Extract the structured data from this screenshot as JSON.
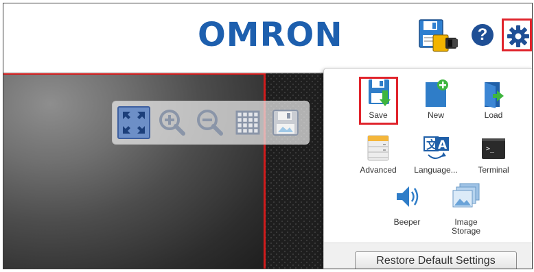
{
  "header": {
    "brand": "OMRON",
    "brand_color": "#1d5fae",
    "icons": [
      "save-to-camera-icon",
      "help-icon",
      "gear-icon"
    ],
    "help_glyph": "?"
  },
  "viewer_toolbar": {
    "buttons": [
      "fit-to-window-icon",
      "zoom-in-icon",
      "zoom-out-icon",
      "grid-icon",
      "save-image-icon"
    ]
  },
  "settings_menu": {
    "items": [
      {
        "label": "Save",
        "icon": "save-icon"
      },
      {
        "label": "New",
        "icon": "new-file-icon"
      },
      {
        "label": "Load",
        "icon": "load-icon"
      },
      {
        "label": "Advanced",
        "icon": "advanced-icon"
      },
      {
        "label": "Language...",
        "icon": "language-icon"
      },
      {
        "label": "Terminal",
        "icon": "terminal-icon"
      },
      {
        "label": "Beeper",
        "icon": "speaker-icon"
      },
      {
        "label": "Image Storage",
        "icon": "image-storage-icon"
      }
    ],
    "terminal_prompt": ">_",
    "restore_button": "Restore Default Settings"
  },
  "highlight_color": "#e0242c"
}
